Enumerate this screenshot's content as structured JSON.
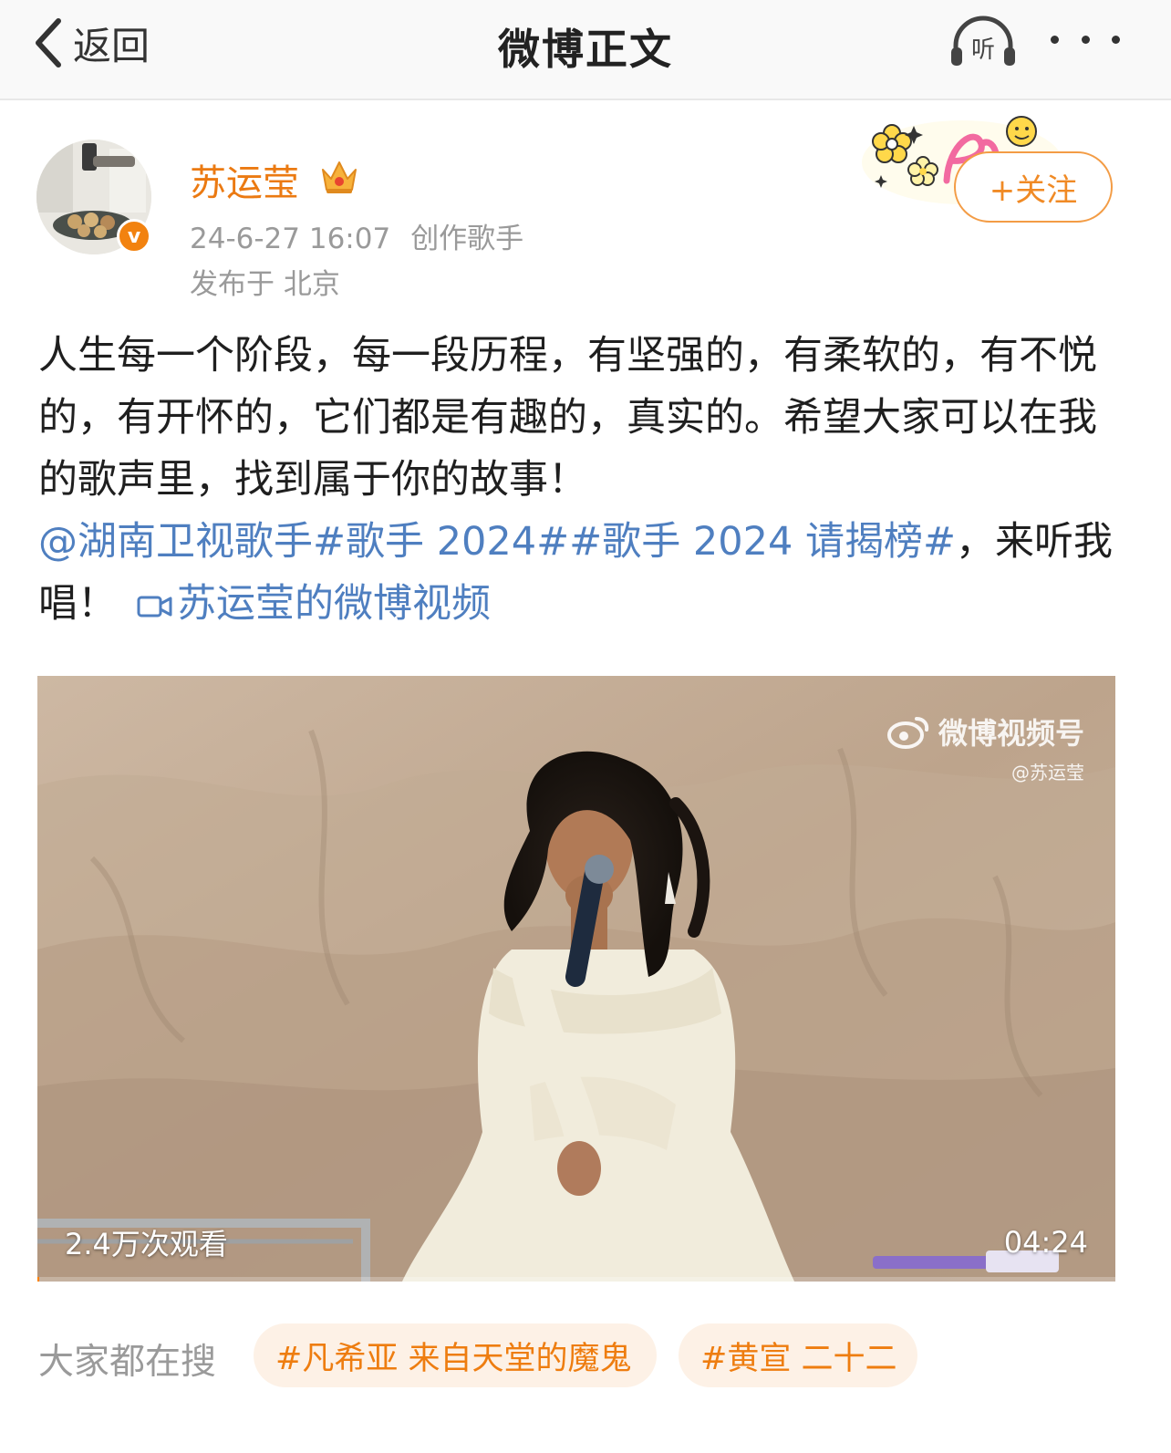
{
  "nav": {
    "back_label": "返回",
    "title": "微博正文",
    "listen_label": "听"
  },
  "author": {
    "name": "苏运莹",
    "verified_badge": "v",
    "timestamp": "24-6-27 16:07",
    "role": "创作歌手",
    "location": "发布于 北京",
    "follow_label": "+关注"
  },
  "post": {
    "text": "人生每一个阶段，每一段历程，有坚强的，有柔软的，有不悦的，有开怀的，它们都是有趣的，真实的。希望大家可以在我的歌声里，找到属于你的故事！",
    "mention": "@湖南卫视歌手",
    "hashtag1": "#歌手 2024#",
    "hashtag2": "#歌手 2024 请揭榜#",
    "tail": "，来听我唱！",
    "video_link": "苏运莹的微博视频"
  },
  "video": {
    "watermark_title": "微博视频号",
    "watermark_sub": "@苏运莹",
    "views": "2.4万次观看",
    "duration": "04:24",
    "progress": 0
  },
  "trending": {
    "label": "大家都在搜",
    "items": [
      "#凡希亚 来自天堂的魔鬼",
      "#黄宣 二十二"
    ]
  },
  "colors": {
    "accent": "#eb7a12",
    "link": "#4f7fc0",
    "pill_bg": "#fdf1e6"
  },
  "icons": [
    "back-chevron-icon",
    "headphones-icon",
    "more-dots-icon",
    "crown-icon",
    "video-camera-icon",
    "weibo-logo-icon"
  ]
}
